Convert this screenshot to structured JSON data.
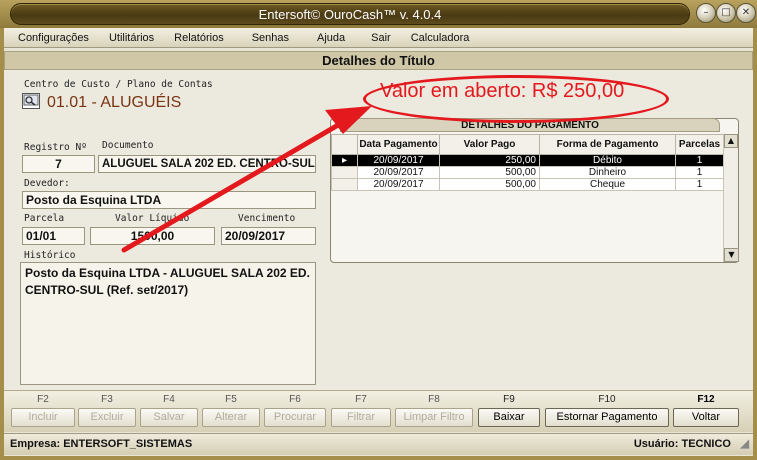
{
  "window": {
    "title": "Entersoft© OuroCash™ v. 4.0.4",
    "buttons": [
      "minimize-icon",
      "maximize-icon",
      "close-icon"
    ]
  },
  "menu": [
    "Configurações",
    "Utilitários",
    "Relatórios",
    "Senhas",
    "Ajuda",
    "Sair",
    "Calculadora"
  ],
  "section_title": "Detalhes do Título",
  "centro_custo": {
    "label": "Centro de Custo / Plano de Contas",
    "value": "01.01 - ALUGUÉIS",
    "icon": "search-document-icon"
  },
  "registro": {
    "label": "Registro Nº",
    "value": "7"
  },
  "documento": {
    "label": "Documento",
    "value": "ALUGUEL SALA 202 ED. CENTRO-SUL"
  },
  "devedor": {
    "label": "Devedor:",
    "value": "Posto da Esquina LTDA"
  },
  "parcela": {
    "label": "Parcela",
    "value": "01/01"
  },
  "valor_liquido": {
    "label": "Valor Líquido",
    "value": "1500,00"
  },
  "vencimento": {
    "label": "Vencimento",
    "value": "20/09/2017"
  },
  "historico": {
    "label": "Histórico",
    "value": "Posto da Esquina LTDA - ALUGUEL SALA 202 ED. CENTRO-SUL (Ref. set/2017)"
  },
  "annotation": {
    "text": "Valor em aberto:  R$ 250,00",
    "color": "#e4191e"
  },
  "detalhes_pagamento": {
    "title": "DETALHES DO PAGAMENTO",
    "columns": [
      "Data Pagamento",
      "Valor Pago",
      "Forma de Pagamento",
      "Parcelas"
    ],
    "rows": [
      [
        "20/09/2017",
        "250,00",
        "Débito",
        "1"
      ],
      [
        "20/09/2017",
        "500,00",
        "Dinheiro",
        "1"
      ],
      [
        "20/09/2017",
        "500,00",
        "Cheque",
        "1"
      ]
    ],
    "selected_row": 0
  },
  "fkeys": [
    {
      "key": "F2",
      "label": "Incluir",
      "enabled": false
    },
    {
      "key": "F3",
      "label": "Excluir",
      "enabled": false
    },
    {
      "key": "F4",
      "label": "Salvar",
      "enabled": false
    },
    {
      "key": "F5",
      "label": "Alterar",
      "enabled": false
    },
    {
      "key": "F6",
      "label": "Procurar",
      "enabled": false
    },
    {
      "key": "F7",
      "label": "Filtrar",
      "enabled": false
    },
    {
      "key": "F8",
      "label": "Limpar Filtro",
      "enabled": false
    },
    {
      "key": "F9",
      "label": "Baixar",
      "enabled": true
    },
    {
      "key": "F10",
      "label": "Estornar Pagamento",
      "enabled": true
    },
    {
      "key": "F12",
      "label": "Voltar",
      "enabled": true
    }
  ],
  "status": {
    "empresa": "Empresa: ENTERSOFT_SISTEMAS",
    "usuario": "Usuário: TECNICO"
  },
  "colors": {
    "title_bar": "#5a471a",
    "accent": "#7a3412",
    "annotation": "#e4191e",
    "selected_row": "#000000"
  }
}
